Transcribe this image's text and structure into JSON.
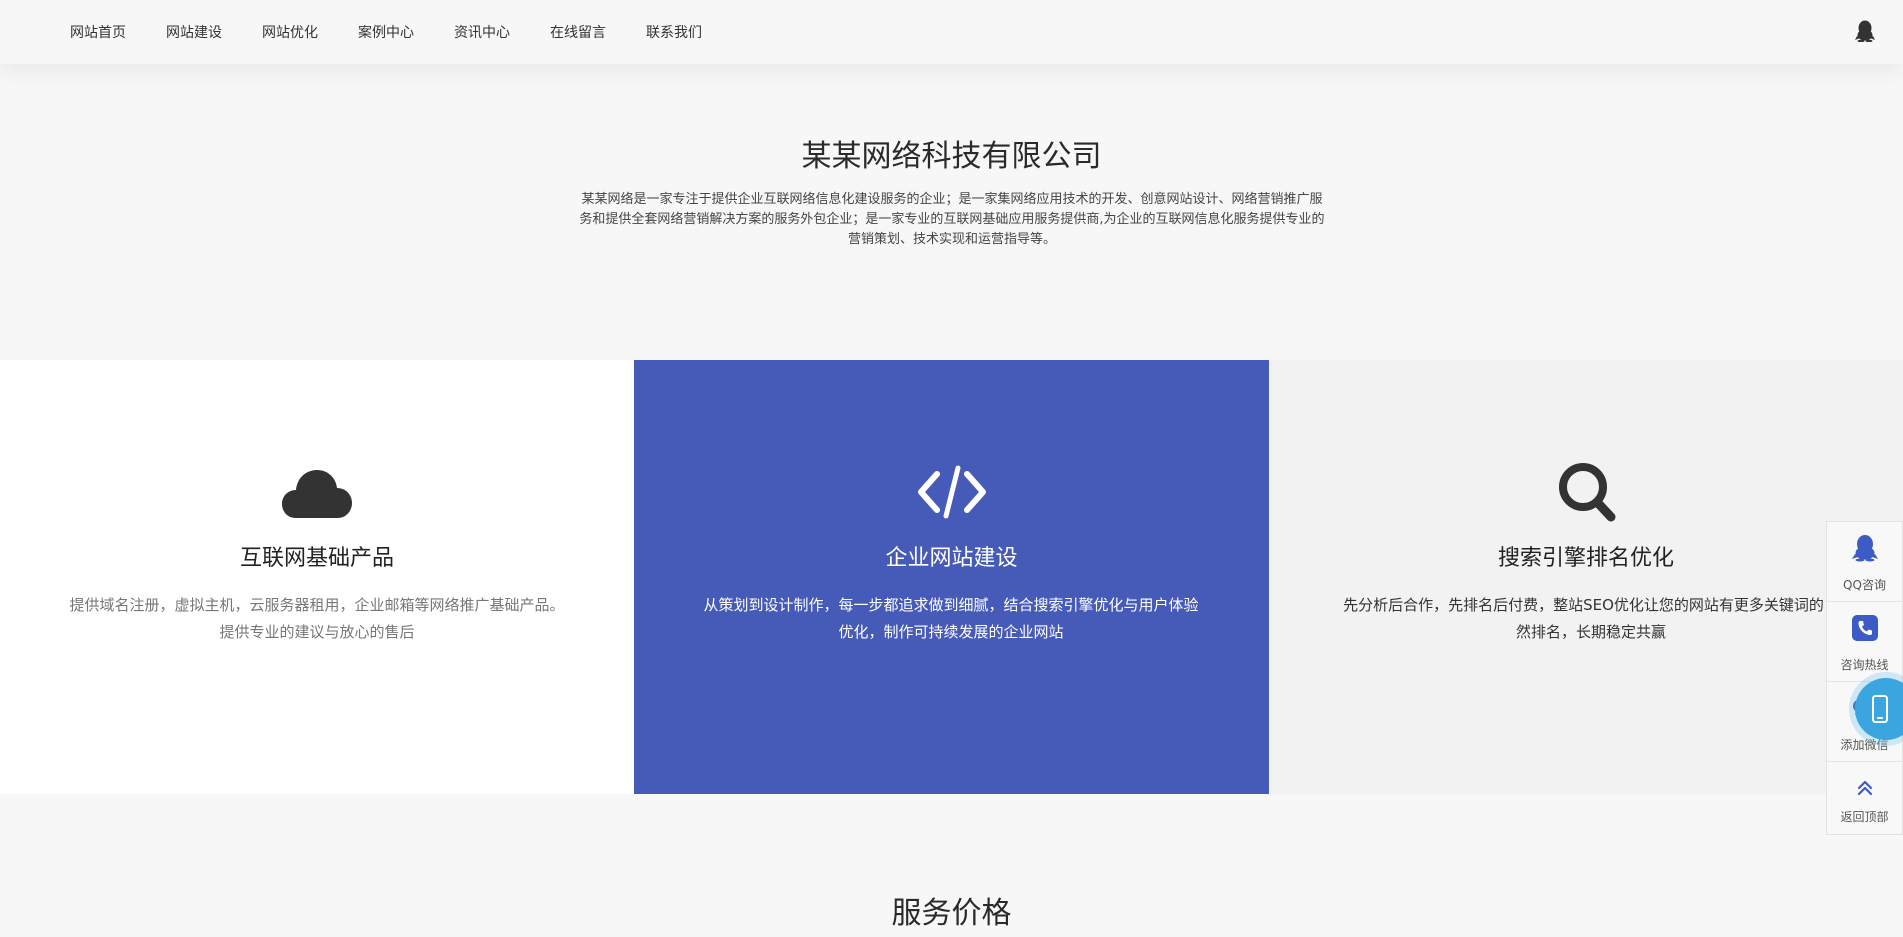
{
  "nav": {
    "items": [
      {
        "label": "网站首页"
      },
      {
        "label": "网站建设"
      },
      {
        "label": "网站优化"
      },
      {
        "label": "案例中心"
      },
      {
        "label": "资讯中心"
      },
      {
        "label": "在线留言"
      },
      {
        "label": "联系我们"
      }
    ],
    "qq_icon": "qq-penguin-icon"
  },
  "intro": {
    "title": "某某网络科技有限公司",
    "description": "某某网络是一家专注于提供企业互联网络信息化建设服务的企业；是一家集网络应用技术的开发、创意网站设计、网络营销推广服务和提供全套网络营销解决方案的服务外包企业；是一家专业的互联网基础应用服务提供商,为企业的互联网信息化服务提供专业的营销策划、技术实现和运营指导等。"
  },
  "features": [
    {
      "icon": "cloud-icon",
      "title": "互联网基础产品",
      "desc": "提供域名注册，虚拟主机，云服务器租用，企业邮箱等网络推广基础产品。提供专业的建议与放心的售后"
    },
    {
      "icon": "code-icon",
      "title": "企业网站建设",
      "desc": "从策划到设计制作，每一步都追求做到细腻，结合搜索引擎优化与用户体验优化，制作可持续发展的企业网站",
      "highlight_color": "#465bb8"
    },
    {
      "icon": "search-icon",
      "title": "搜索引擎排名优化",
      "desc": "先分析后合作，先排名后付费，整站SEO优化让您的网站有更多关键词的自然排名，长期稳定共赢"
    }
  ],
  "pricing": {
    "title": "服务价格"
  },
  "sidebar": {
    "items": [
      {
        "label": "QQ咨询",
        "icon": "qq-penguin-icon"
      },
      {
        "label": "咨询热线",
        "icon": "phone-icon"
      },
      {
        "label": "添加微信",
        "icon": "wechat-icon"
      },
      {
        "label": "返回顶部",
        "icon": "double-chevron-up-icon"
      }
    ],
    "accent": "#3d5bc4"
  },
  "mobile_button": {
    "icon": "mobile-phone-icon",
    "color": "#3ba5e0"
  }
}
